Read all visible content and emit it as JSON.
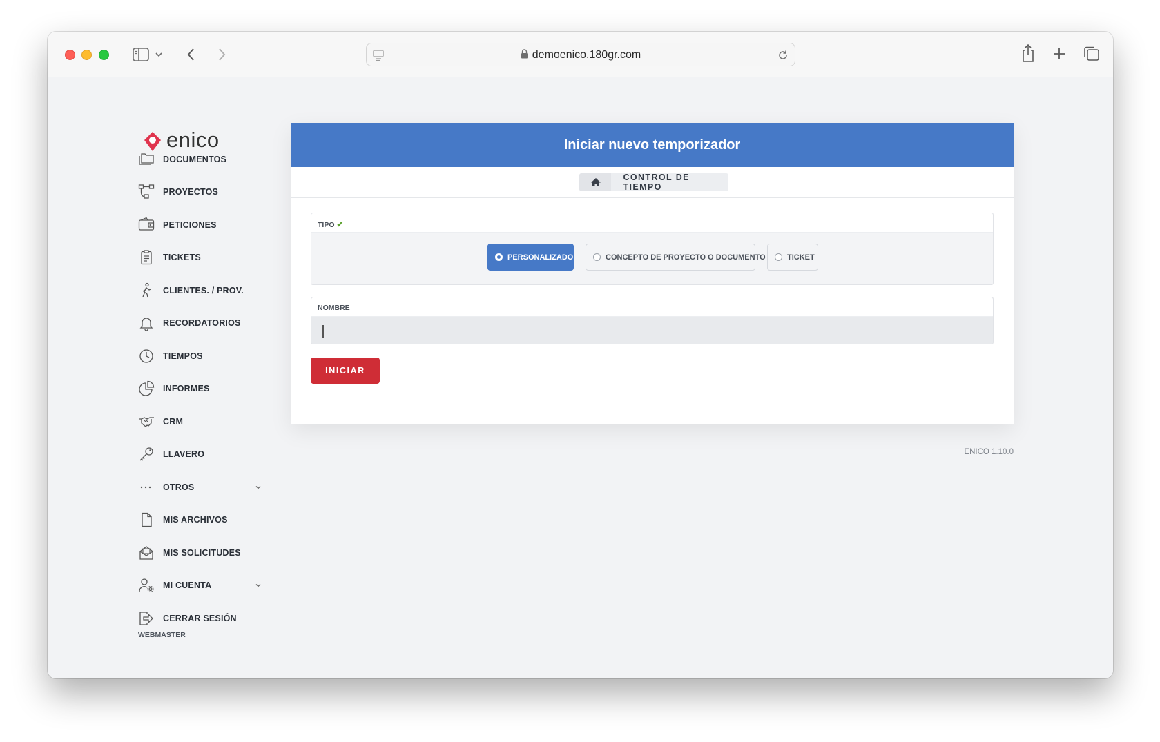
{
  "browser": {
    "url": "demoenico.180gr.com"
  },
  "app": {
    "logo_text": "enico",
    "brand_color": "#e0344e",
    "accent_color": "#4679c7",
    "danger_color": "#cf2d36",
    "version": "ENICO 1.10.0"
  },
  "sidebar": {
    "items": [
      {
        "label": "DOCUMENTOS",
        "icon": "folders-icon"
      },
      {
        "label": "PROYECTOS",
        "icon": "project-tree-icon"
      },
      {
        "label": "PETICIONES",
        "icon": "wallet-icon"
      },
      {
        "label": "TICKETS",
        "icon": "clipboard-icon"
      },
      {
        "label": "CLIENTES. / PROV.",
        "icon": "person-walking-icon"
      },
      {
        "label": "RECORDATORIOS",
        "icon": "bell-icon"
      },
      {
        "label": "TIEMPOS",
        "icon": "clock-icon"
      },
      {
        "label": "INFORMES",
        "icon": "pie-chart-icon"
      },
      {
        "label": "CRM",
        "icon": "handshake-icon"
      },
      {
        "label": "LLAVERO",
        "icon": "key-icon"
      },
      {
        "label": "OTROS",
        "icon": "ellipsis-icon"
      },
      {
        "label": "MIS ARCHIVOS",
        "icon": "file-icon"
      },
      {
        "label": "MIS SOLICITUDES",
        "icon": "envelope-open-icon"
      },
      {
        "label": "MI CUENTA",
        "icon": "user-gear-icon"
      },
      {
        "label": "CERRAR SESIÓN",
        "icon": "sign-out-icon"
      }
    ],
    "logout_user": "WEBMASTER"
  },
  "main": {
    "title": "Iniciar nuevo temporizador",
    "breadcrumb": {
      "home_icon": "home-icon",
      "current": "CONTROL DE TIEMPO"
    },
    "tipo": {
      "label": "TIPO",
      "check": "✔",
      "options": [
        {
          "label": "PERSONALIZADO",
          "selected": true
        },
        {
          "label": "CONCEPTO DE PROYECTO O DOCUMENTO",
          "selected": false
        },
        {
          "label": "TICKET",
          "selected": false
        }
      ]
    },
    "nombre": {
      "label": "NOMBRE",
      "value": "",
      "placeholder": ""
    },
    "start_button": "INICIAR"
  }
}
